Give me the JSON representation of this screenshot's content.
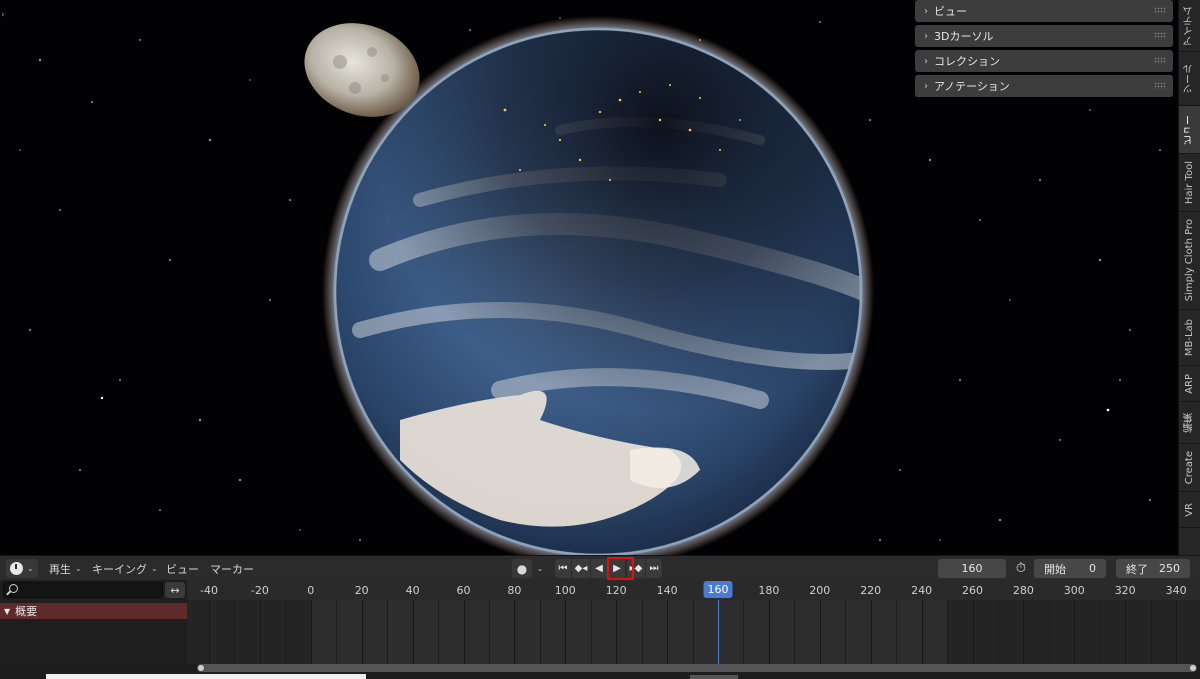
{
  "viewport": {
    "panel_sections": [
      "ビュー",
      "3Dカーソル",
      "コレクション",
      "アノテーション"
    ],
    "tabs": [
      "アイテム",
      "ツール",
      "ビュー",
      "Hair Tool",
      "Simply Cloth Pro",
      "MB-Lab",
      "ARP",
      "編集",
      "Create",
      "VR"
    ],
    "active_tab": "ビュー"
  },
  "timeline": {
    "menus": {
      "playback": "再生",
      "keying": "キーイング",
      "view": "ビュー",
      "marker": "マーカー"
    },
    "current_frame": "160",
    "start_label": "開始",
    "start_value": "0",
    "end_label": "終了",
    "end_value": "250",
    "ruler_ticks": [
      "-40",
      "-20",
      "0",
      "20",
      "40",
      "60",
      "80",
      "100",
      "120",
      "140",
      "160",
      "180",
      "200",
      "220",
      "240",
      "260",
      "280",
      "300",
      "320",
      "340"
    ],
    "summary_label": "概要",
    "swap_icon": "↔"
  },
  "colors": {
    "accent": "#4a7ad1",
    "highlight_box": "#e01010",
    "summary_row": "#5e2a2b"
  }
}
